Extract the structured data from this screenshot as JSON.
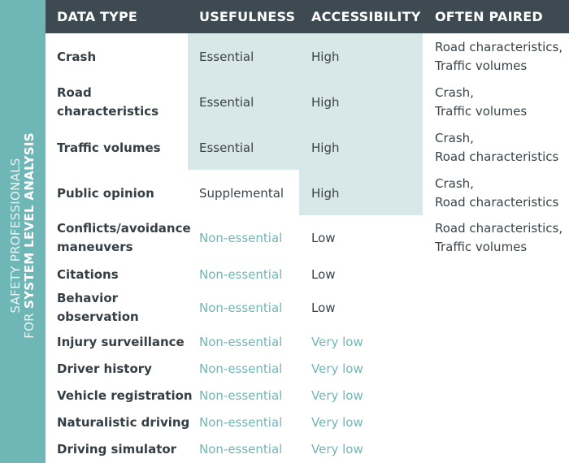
{
  "sidebar": {
    "line1": "SAFETY PROFESSIONALS",
    "line2_prefix": "FOR ",
    "line2_bold": "SYSTEM LEVEL ANALYSIS"
  },
  "colors": {
    "header_bg": "#3d4a52",
    "sidebar_bg": "#6fb7b7",
    "highlight_bg": "#d8e7e8",
    "muted_text": "#6fb7b7"
  },
  "header": {
    "columns": [
      "DATA TYPE",
      "USEFULNESS",
      "ACCESSIBILITY",
      "OFTEN PAIRED"
    ]
  },
  "rows": [
    {
      "type": "Crash",
      "usefulness": "Essential",
      "accessibility": "High",
      "paired": "Road characteristics,\nTraffic volumes"
    },
    {
      "type": "Road\ncharacteristics",
      "usefulness": "Essential",
      "accessibility": "High",
      "paired": "Crash,\nTraffic volumes"
    },
    {
      "type": "Traffic volumes",
      "usefulness": "Essential",
      "accessibility": "High",
      "paired": "Crash,\nRoad characteristics"
    },
    {
      "type": "Public opinion",
      "usefulness": "Supplemental",
      "accessibility": "High",
      "paired": "Crash,\nRoad characteristics"
    },
    {
      "type": "Conflicts/avoidance\nmaneuvers",
      "usefulness": "Non-essential",
      "accessibility": "Low",
      "paired": "Road characteristics,\nTraffic volumes"
    },
    {
      "type": "Citations",
      "usefulness": "Non-essential",
      "accessibility": "Low",
      "paired": ""
    },
    {
      "type": "Behavior\nobservation",
      "usefulness": "Non-essential",
      "accessibility": "Low",
      "paired": ""
    },
    {
      "type": "Injury surveillance",
      "usefulness": "Non-essential",
      "accessibility": "Very low",
      "paired": ""
    },
    {
      "type": "Driver history",
      "usefulness": "Non-essential",
      "accessibility": "Very low",
      "paired": ""
    },
    {
      "type": "Vehicle registration",
      "usefulness": "Non-essential",
      "accessibility": "Very low",
      "paired": ""
    },
    {
      "type": "Naturalistic driving",
      "usefulness": "Non-essential",
      "accessibility": "Very low",
      "paired": ""
    },
    {
      "type": "Driving simulator",
      "usefulness": "Non-essential",
      "accessibility": "Very low",
      "paired": ""
    }
  ]
}
